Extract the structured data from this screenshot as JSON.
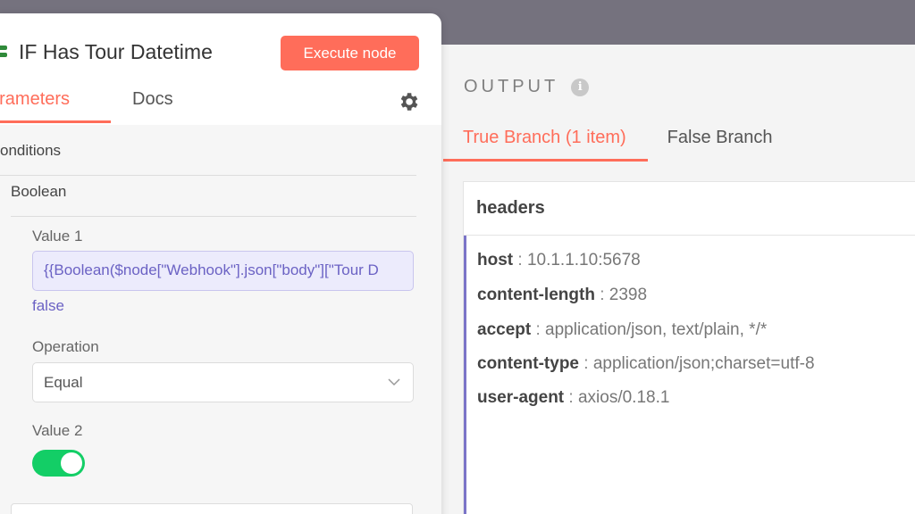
{
  "node": {
    "title": "IF Has Tour Datetime",
    "execute_label": "Execute node"
  },
  "params": {
    "tabs": {
      "parameters": "arameters",
      "docs": "Docs"
    },
    "conditions_label": "onditions",
    "boolean_label": "Boolean",
    "value1": {
      "label": "Value 1",
      "expression": "{{Boolean($node[\"Webhook\"].json[\"body\"][\"Tour D",
      "result": "false"
    },
    "operation": {
      "label": "Operation",
      "selected": "Equal"
    },
    "value2": {
      "label": "Value 2",
      "toggle_on": true
    }
  },
  "output": {
    "title": "OUTPUT",
    "info_glyph": "i",
    "tabs": {
      "true_branch": "True Branch (1 item)",
      "false_branch": "False Branch"
    },
    "section": "headers",
    "rows": [
      {
        "key": "host",
        "value": "10.1.1.10:5678"
      },
      {
        "key": "content-length",
        "value": "2398"
      },
      {
        "key": "accept",
        "value": "application/json, text/plain, */*"
      },
      {
        "key": "content-type",
        "value": "application/json;charset=utf-8"
      },
      {
        "key": "user-agent",
        "value": "axios/0.18.1"
      }
    ]
  },
  "colors": {
    "accent": "#ff6d5a",
    "expression": "#6b62c4",
    "toggle_on": "#13ce66",
    "backdrop": "#75727e"
  },
  "icons": [
    "node-icon",
    "info-icon",
    "gear-icon",
    "chevron-down-icon"
  ]
}
